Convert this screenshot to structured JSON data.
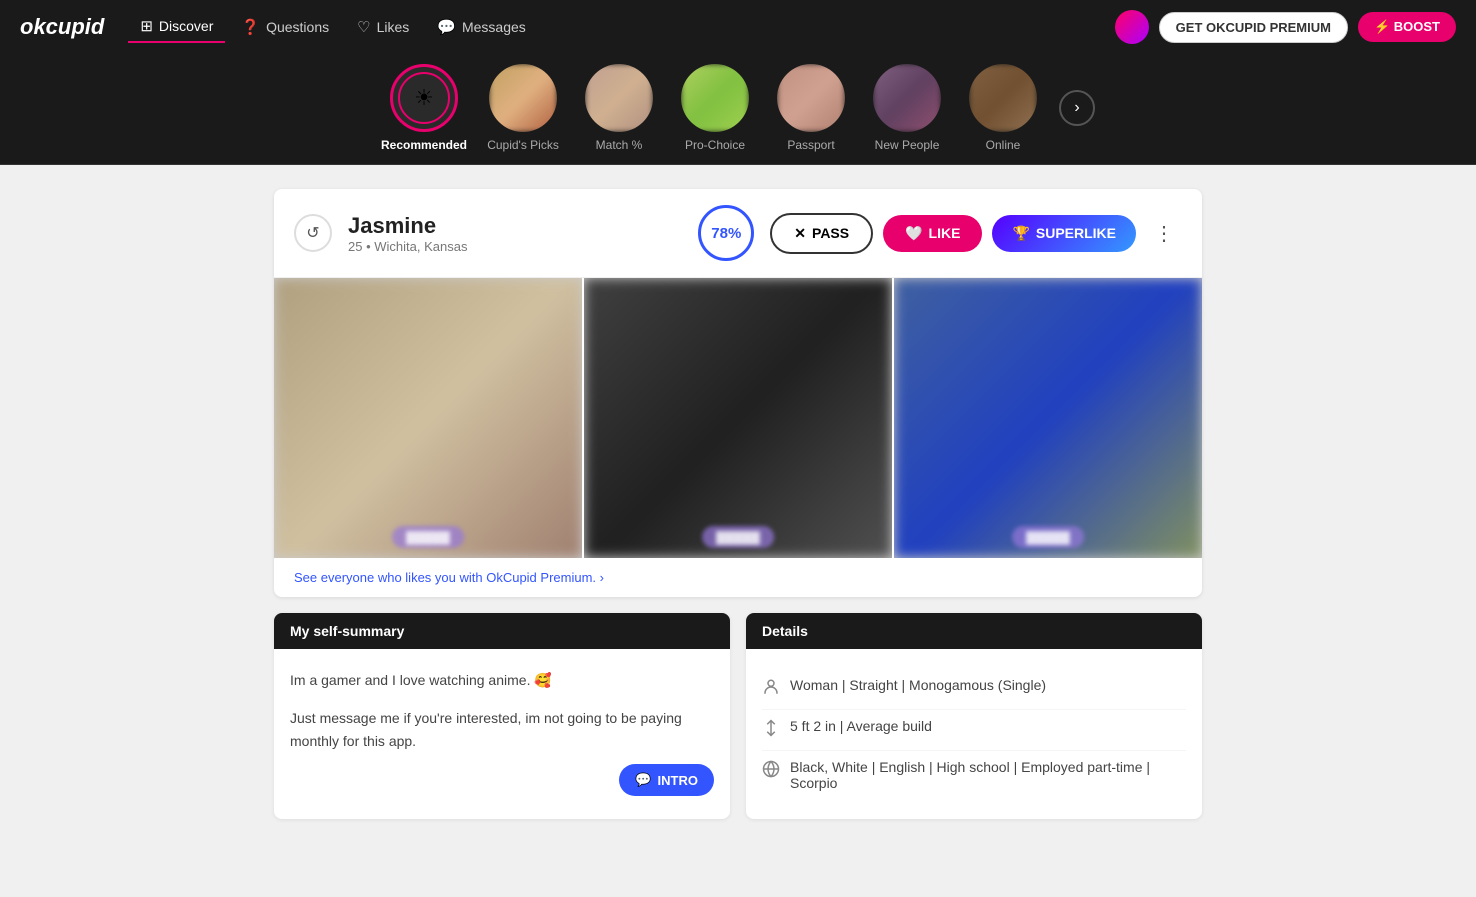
{
  "app": {
    "logo": "okcupid",
    "nav": [
      {
        "id": "discover",
        "label": "Discover",
        "active": true,
        "icon": "⊞"
      },
      {
        "id": "questions",
        "label": "Questions",
        "active": false,
        "icon": "?"
      },
      {
        "id": "likes",
        "label": "Likes",
        "active": false,
        "icon": "♡"
      },
      {
        "id": "messages",
        "label": "Messages",
        "active": false,
        "icon": "💬"
      }
    ],
    "btn_premium": "GET OKCUPID PREMIUM",
    "btn_boost": "⚡ BOOST"
  },
  "categories": [
    {
      "id": "recommended",
      "label": "Recommended",
      "active": true,
      "icon": "sun"
    },
    {
      "id": "cupids_picks",
      "label": "Cupid's Picks",
      "active": false
    },
    {
      "id": "match_pct",
      "label": "Match %",
      "active": false
    },
    {
      "id": "pro_choice",
      "label": "Pro-Choice",
      "active": false
    },
    {
      "id": "passport",
      "label": "Passport",
      "active": false
    },
    {
      "id": "new_people",
      "label": "New People",
      "active": false
    },
    {
      "id": "online",
      "label": "Online",
      "active": false
    }
  ],
  "profile": {
    "name": "Jasmine",
    "age": "25",
    "location": "Wichita, Kansas",
    "match_pct": "78%",
    "btn_pass": "PASS",
    "btn_like": "LIKE",
    "btn_superlike": "SUPERLIKE",
    "premium_link": "See everyone who likes you with OkCupid Premium. ›",
    "self_summary_label": "My self-summary",
    "self_summary_text1": "Im a gamer and I love watching anime. 🥰",
    "self_summary_text2": "Just message me if you're interested, im not going to be paying monthly for this app.",
    "btn_intro": "INTRO",
    "details_label": "Details",
    "details": [
      {
        "icon": "person",
        "text": "Woman | Straight | Monogamous (Single)"
      },
      {
        "icon": "height",
        "text": "5 ft 2 in | Average build"
      },
      {
        "icon": "globe",
        "text": "Black, White | English | High school | Employed part-time | Scorpio"
      }
    ]
  }
}
